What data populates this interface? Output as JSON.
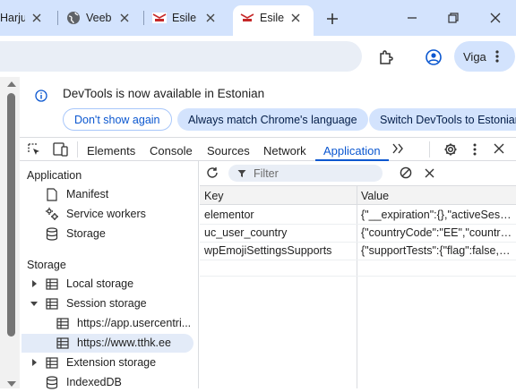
{
  "browser": {
    "tabs": [
      {
        "title": "Harju",
        "favicon": "generic"
      },
      {
        "title": "Veeb",
        "favicon": "globe-icon"
      },
      {
        "title": "Esileh",
        "favicon": "tthk-logo"
      },
      {
        "title": "Esileh",
        "favicon": "tthk-logo",
        "active": true
      }
    ],
    "profile_label": "Viga"
  },
  "infobar": {
    "message": "DevTools is now available in Estonian",
    "dont_show": "Don't show again",
    "match_language": "Always match Chrome's language",
    "switch_language": "Switch DevTools to Estonian"
  },
  "devtools": {
    "tabs": [
      "Elements",
      "Console",
      "Sources",
      "Network",
      "Application"
    ],
    "active_tab": "Application"
  },
  "sidebar": {
    "application_header": "Application",
    "application_items": [
      {
        "label": "Manifest",
        "icon": "file-icon"
      },
      {
        "label": "Service workers",
        "icon": "gears-icon"
      },
      {
        "label": "Storage",
        "icon": "database-icon"
      }
    ],
    "storage_header": "Storage",
    "storage_items": [
      {
        "label": "Local storage",
        "icon": "table-icon"
      },
      {
        "label": "Session storage",
        "icon": "table-icon"
      },
      {
        "label": "https://app.usercentri...",
        "icon": "table-icon"
      },
      {
        "label": "https://www.tthk.ee",
        "icon": "table-icon",
        "selected": true
      },
      {
        "label": "Extension storage",
        "icon": "table-icon"
      },
      {
        "label": "IndexedDB",
        "icon": "database-icon"
      }
    ]
  },
  "storage_view": {
    "filter_placeholder": "Filter",
    "columns": [
      "Key",
      "Value"
    ],
    "rows": [
      {
        "key": "elementor",
        "value": "{\"__expiration\":{},\"activeSessio..."
      },
      {
        "key": "uc_user_country",
        "value": "{\"countryCode\":\"EE\",\"country..."
      },
      {
        "key": "wpEmojiSettingsSupports",
        "value": "{\"supportTests\":{\"flag\":false,\"e..."
      }
    ]
  },
  "colors": {
    "accent": "#0b57d0",
    "tabstrip": "#d3e3fd",
    "selection": "#e3ebf8"
  }
}
